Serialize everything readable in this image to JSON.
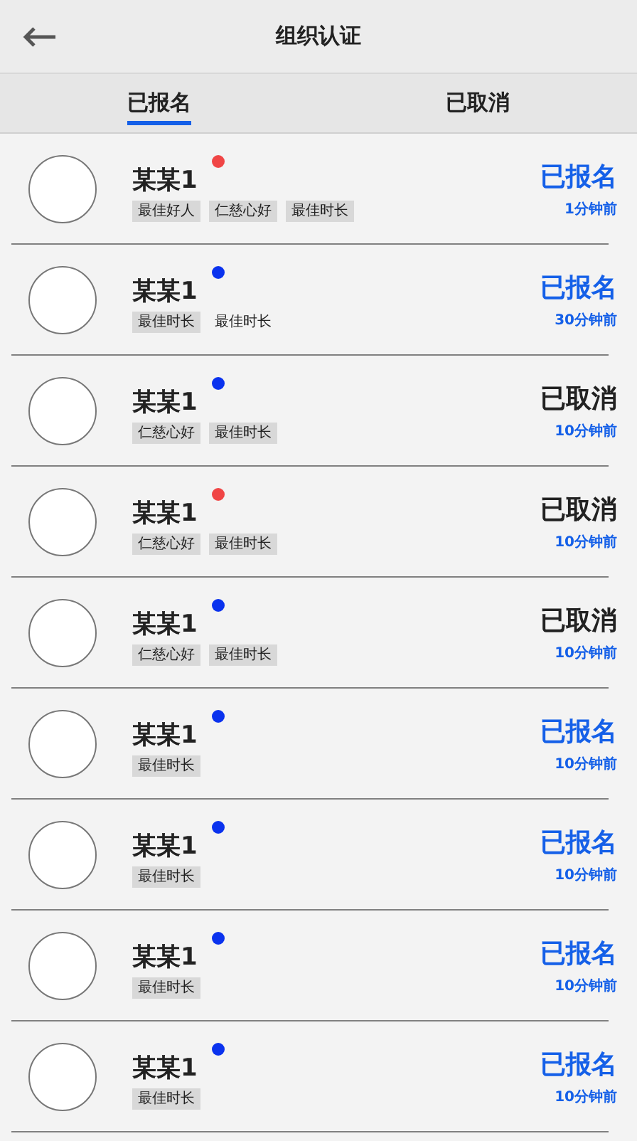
{
  "header": {
    "title": "组织认证"
  },
  "tabs": [
    {
      "label": "已报名",
      "selected": true
    },
    {
      "label": "已取消",
      "selected": false
    }
  ],
  "rows": [
    {
      "name": "某某1",
      "color": "#f04545",
      "tags": [
        {
          "text": "最佳好人",
          "boxed": true
        },
        {
          "text": "仁慈心好",
          "boxed": true
        },
        {
          "text": "最佳时长",
          "boxed": true
        }
      ],
      "status": {
        "label": "已报名",
        "kind": "signed"
      },
      "time": "1分钟前"
    },
    {
      "name": "某某1",
      "color": "#0a32ee",
      "tags": [
        {
          "text": "最佳时长",
          "boxed": true
        },
        {
          "text": "最佳时长",
          "boxed": false
        }
      ],
      "status": {
        "label": "已报名",
        "kind": "signed"
      },
      "time": "30分钟前"
    },
    {
      "name": "某某1",
      "color": "#0a32ee",
      "tags": [
        {
          "text": "仁慈心好",
          "boxed": true
        },
        {
          "text": "最佳时长",
          "boxed": true
        }
      ],
      "status": {
        "label": "已取消",
        "kind": "cancelled"
      },
      "time": "10分钟前"
    },
    {
      "name": "某某1",
      "color": "#f04545",
      "tags": [
        {
          "text": "仁慈心好",
          "boxed": true
        },
        {
          "text": "最佳时长",
          "boxed": true
        }
      ],
      "status": {
        "label": "已取消",
        "kind": "cancelled"
      },
      "time": "10分钟前"
    },
    {
      "name": "某某1",
      "color": "#0a32ee",
      "tags": [
        {
          "text": "仁慈心好",
          "boxed": true
        },
        {
          "text": "最佳时长",
          "boxed": true
        }
      ],
      "status": {
        "label": "已取消",
        "kind": "cancelled"
      },
      "time": "10分钟前"
    },
    {
      "name": "某某1",
      "color": "#0a32ee",
      "tags": [
        {
          "text": "最佳时长",
          "boxed": true
        }
      ],
      "status": {
        "label": "已报名",
        "kind": "signed"
      },
      "time": "10分钟前"
    },
    {
      "name": "某某1",
      "color": "#0a32ee",
      "tags": [
        {
          "text": "最佳时长",
          "boxed": true
        }
      ],
      "status": {
        "label": "已报名",
        "kind": "signed"
      },
      "time": "10分钟前"
    },
    {
      "name": "某某1",
      "color": "#0a32ee",
      "tags": [
        {
          "text": "最佳时长",
          "boxed": true
        }
      ],
      "status": {
        "label": "已报名",
        "kind": "signed"
      },
      "time": "10分钟前"
    },
    {
      "name": "某某1",
      "color": "#0a32ee",
      "tags": [
        {
          "text": "最佳时长",
          "boxed": true
        }
      ],
      "status": {
        "label": "已报名",
        "kind": "signed"
      },
      "time": "10分钟前"
    }
  ]
}
